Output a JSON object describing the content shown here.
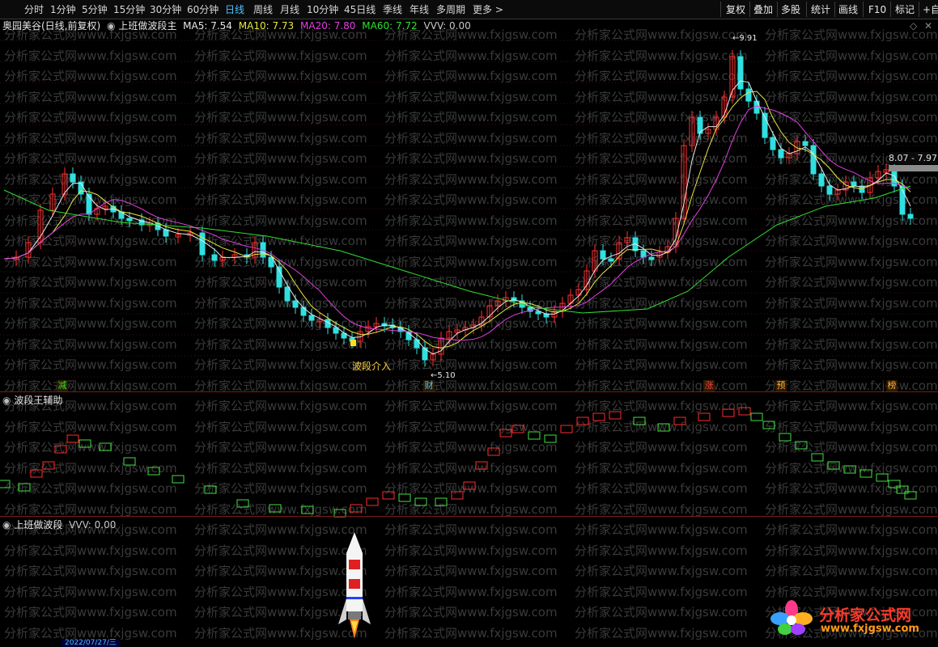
{
  "toolbar": {
    "periods": [
      "分时",
      "1分钟",
      "5分钟",
      "15分钟",
      "30分钟",
      "60分钟",
      "日线",
      "周线",
      "月线",
      "10分钟",
      "45日线",
      "季线",
      "年线",
      "多周期",
      "更多 >"
    ],
    "active_period": "日线",
    "right_buttons": [
      "复权",
      "叠加",
      "多股",
      "统计",
      "画线",
      "F10",
      "标记",
      "+自选"
    ]
  },
  "main_panel": {
    "stock_name": "奥园美谷(日线,前复权)",
    "indicator_name": "上班做波段主",
    "ma": [
      {
        "label": "MA5: 7.54",
        "color": "#e8e8e8"
      },
      {
        "label": "MA10: 7.73",
        "color": "#e8e840"
      },
      {
        "label": "MA20: 7.80",
        "color": "#e040e0"
      },
      {
        "label": "MA60: 7.72",
        "color": "#30e030"
      },
      {
        "label": "VVV: 0.00",
        "color": "#c8c8c8"
      }
    ],
    "high_label": "9.91",
    "low_label": "5.10",
    "price_box": "8.07 - 7.97",
    "signal_label": "波段介入",
    "event_tags": [
      {
        "text": "减",
        "color": "#30e030"
      },
      {
        "text": "财",
        "color": "#4fc3ff"
      },
      {
        "text": "涨",
        "color": "#ff4040"
      },
      {
        "text": "预",
        "color": "#ffb040"
      },
      {
        "text": "榜",
        "color": "#ffb040"
      }
    ]
  },
  "aux_panel": {
    "title": "波段王辅助"
  },
  "bottom_panel": {
    "title": "上班做波段",
    "vvv": "VVV: 0.00"
  },
  "bottom_axis": {
    "date_label": "2022/07/27/三"
  },
  "watermark": {
    "text": "分析家公式网www.fxjgsw.com"
  },
  "brand": {
    "name": "分析家公式网",
    "url": "www.fxjgsw.com"
  },
  "colors": {
    "up": "#ff3030",
    "down": "#30e0e0",
    "bg": "#000000",
    "grid": "#7a1a1a"
  }
}
